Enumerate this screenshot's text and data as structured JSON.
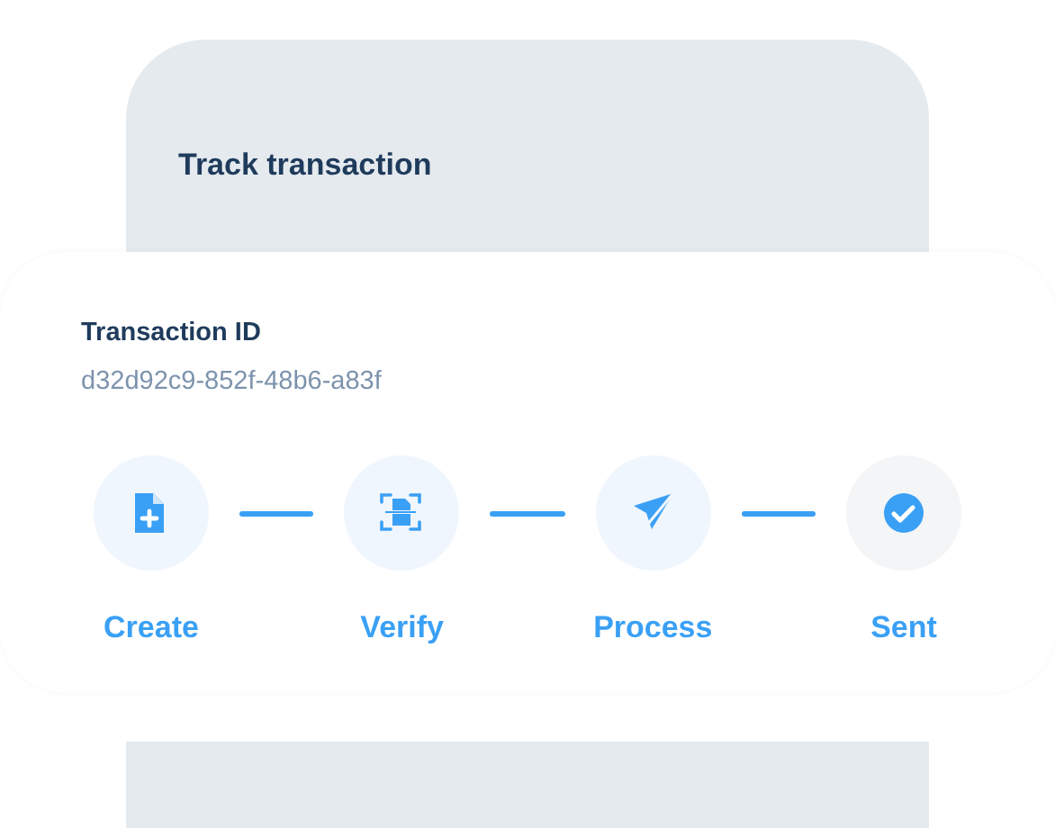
{
  "header": {
    "title": "Track transaction"
  },
  "transaction": {
    "label": "Transaction ID",
    "value": "d32d92c9-852f-48b6-a83f"
  },
  "steps": [
    {
      "kind": "create",
      "label": "Create"
    },
    {
      "kind": "verify",
      "label": "Verify"
    },
    {
      "kind": "process",
      "label": "Process"
    },
    {
      "kind": "sent",
      "label": "Sent"
    }
  ]
}
